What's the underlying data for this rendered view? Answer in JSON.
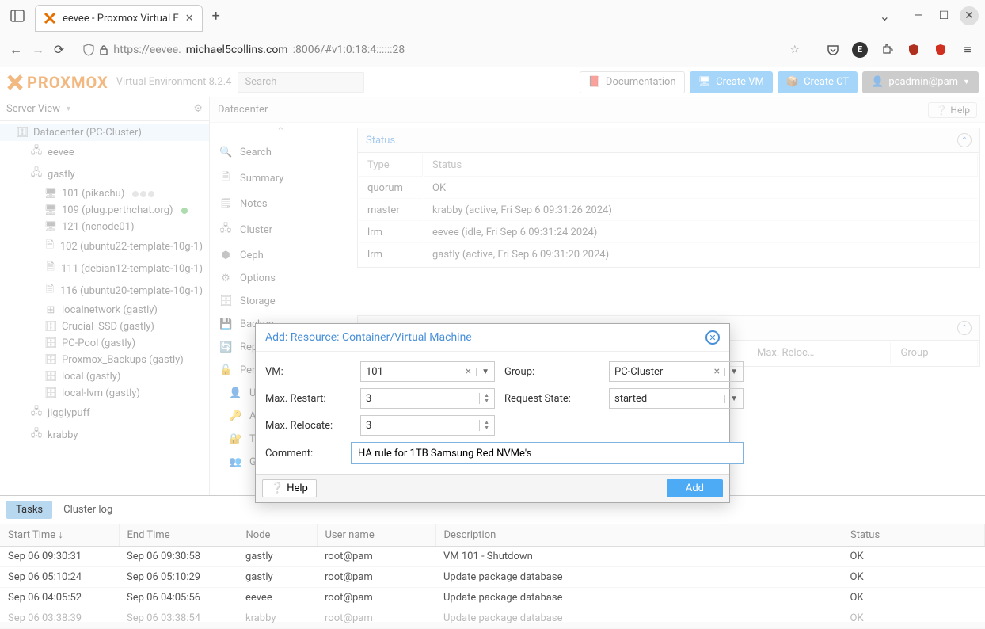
{
  "browser": {
    "tab_title": "eevee - Proxmox Virtual E",
    "url_prefix": "https://eevee.",
    "url_host": "michael5collins.com",
    "url_suffix": ":8006/#v1:0:18:4::::::28"
  },
  "header": {
    "product": "Virtual Environment 8.2.4",
    "search_placeholder": "Search",
    "documentation": "Documentation",
    "create_vm": "Create VM",
    "create_ct": "Create CT",
    "user": "pcadmin@pam"
  },
  "sidebar": {
    "view_label": "Server View",
    "datacenter": "Datacenter (PC-Cluster)",
    "nodes": [
      "eevee",
      "gastly",
      "jigglypuff",
      "krabby"
    ],
    "gastly_children": [
      "101 (pikachu)",
      "109 (plug.perthchat.org)",
      "121 (ncnode01)",
      "102 (ubuntu22-template-10g-1)",
      "111 (debian12-template-10g-1)",
      "116 (ubuntu20-template-10g-1)",
      "localnetwork (gastly)",
      "Crucial_SSD (gastly)",
      "PC-Pool (gastly)",
      "Proxmox_Backups (gastly)",
      "local (gastly)",
      "local-lvm (gastly)"
    ]
  },
  "breadcrumb": "Datacenter",
  "help_label": "Help",
  "mid_nav": [
    "Search",
    "Summary",
    "Notes",
    "Cluster",
    "Ceph",
    "Options",
    "Storage",
    "Backup",
    "Replication",
    "Permissions",
    "Users",
    "API Tokens",
    "Two Factor",
    "Groups"
  ],
  "status": {
    "title": "Status",
    "columns": [
      "Type",
      "Status"
    ],
    "rows": [
      {
        "type": "quorum",
        "status": "OK"
      },
      {
        "type": "master",
        "status": "krabby (active, Fri Sep 6 09:31:26 2024)"
      },
      {
        "type": "lrm",
        "status": "eevee (idle, Fri Sep 6 09:31:24 2024)"
      },
      {
        "type": "lrm",
        "status": "gastly (active, Fri Sep 6 09:31:20 2024)"
      }
    ]
  },
  "resources_cols": [
    "Max. Reloc…",
    "Group"
  ],
  "modal": {
    "title": "Add: Resource: Container/Virtual Machine",
    "labels": {
      "vm": "VM:",
      "group": "Group:",
      "max_restart": "Max. Restart:",
      "request_state": "Request State:",
      "max_relocate": "Max. Relocate:",
      "comment": "Comment:"
    },
    "values": {
      "vm": "101",
      "group": "PC-Cluster",
      "max_restart": "3",
      "request_state": "started",
      "max_relocate": "3",
      "comment": "HA rule for 1TB Samsung Red NVMe's"
    },
    "help": "Help",
    "add": "Add"
  },
  "log": {
    "tabs": [
      "Tasks",
      "Cluster log"
    ],
    "columns": [
      "Start Time ↓",
      "End Time",
      "Node",
      "User name",
      "Description",
      "Status"
    ],
    "rows": [
      {
        "start": "Sep 06 09:30:31",
        "end": "Sep 06 09:30:58",
        "node": "gastly",
        "user": "root@pam",
        "desc": "VM 101 - Shutdown",
        "status": "OK"
      },
      {
        "start": "Sep 06 05:10:24",
        "end": "Sep 06 05:10:29",
        "node": "gastly",
        "user": "root@pam",
        "desc": "Update package database",
        "status": "OK"
      },
      {
        "start": "Sep 06 04:05:52",
        "end": "Sep 06 04:05:56",
        "node": "eevee",
        "user": "root@pam",
        "desc": "Update package database",
        "status": "OK"
      },
      {
        "start": "Sep 06 03:38:39",
        "end": "Sep 06 03:38:54",
        "node": "krabby",
        "user": "root@pam",
        "desc": "Update package database",
        "status": "OK"
      }
    ]
  }
}
